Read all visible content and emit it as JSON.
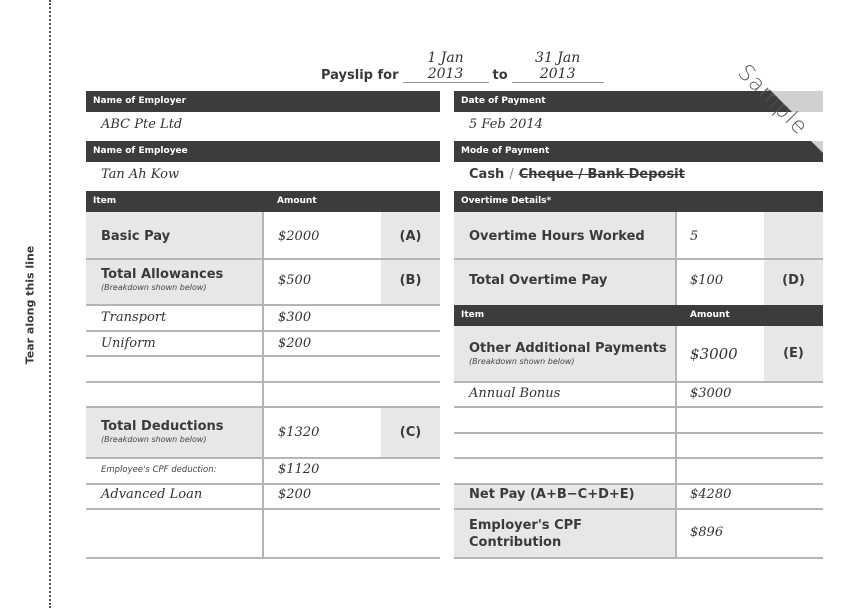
{
  "tear_label": "Tear along this line",
  "watermark": "Sample",
  "header": {
    "title": "Payslip for",
    "from_date": "1 Jan 2013",
    "to_label": "to",
    "to_date": "31 Jan 2013"
  },
  "employer": {
    "label": "Name of Employer",
    "value": "ABC Pte Ltd"
  },
  "employee": {
    "label": "Name of Employee",
    "value": "Tan Ah Kow"
  },
  "payment_date": {
    "label": "Date of Payment",
    "value": "5 Feb 2014"
  },
  "payment_mode": {
    "label": "Mode of Payment",
    "selected": "Cash",
    "separator": "/",
    "struck": "Cheque / Bank Deposit"
  },
  "left_table": {
    "col_item": "Item",
    "col_amount": "Amount",
    "basic_pay": {
      "label": "Basic Pay",
      "amount": "$2000",
      "code": "(A)"
    },
    "allowances": {
      "label": "Total Allowances",
      "note": "(Breakdown shown below)",
      "amount": "$500",
      "code": "(B)",
      "items": [
        {
          "item": "Transport",
          "amount": "$300"
        },
        {
          "item": "Uniform",
          "amount": "$200"
        },
        {
          "item": "",
          "amount": ""
        },
        {
          "item": "",
          "amount": ""
        }
      ]
    },
    "deductions": {
      "label": "Total Deductions",
      "note": "(Breakdown shown below)",
      "amount": "$1320",
      "code": "(C)",
      "items": [
        {
          "item": "Employee's CPF deduction:",
          "amount": "$1120"
        },
        {
          "item": "Advanced Loan",
          "amount": "$200"
        },
        {
          "item": "",
          "amount": ""
        }
      ]
    }
  },
  "right_table": {
    "overtime_header": "Overtime Details*",
    "overtime_hours": {
      "label": "Overtime Hours Worked",
      "value": "5"
    },
    "overtime_pay": {
      "label": "Total Overtime Pay",
      "amount": "$100",
      "code": "(D)"
    },
    "col_item": "Item",
    "col_amount": "Amount",
    "additional": {
      "label": "Other Additional Payments",
      "note": "(Breakdown shown below)",
      "amount": "$3000",
      "code": "(E)",
      "items": [
        {
          "item": "Annual Bonus",
          "amount": "$3000"
        },
        {
          "item": "",
          "amount": ""
        },
        {
          "item": "",
          "amount": ""
        },
        {
          "item": "",
          "amount": ""
        }
      ]
    },
    "net_pay": {
      "label": "Net Pay (A+B−C+D+E)",
      "amount": "$4280"
    },
    "employer_cpf": {
      "label_line1": "Employer's CPF",
      "label_line2": "Contribution",
      "amount": "$896"
    }
  },
  "colors": {
    "header_bar": "#3c3c3c",
    "gray_cell": "#e6e7e8",
    "rule": "#b5b5b5",
    "corner": "#d0d0d0"
  }
}
